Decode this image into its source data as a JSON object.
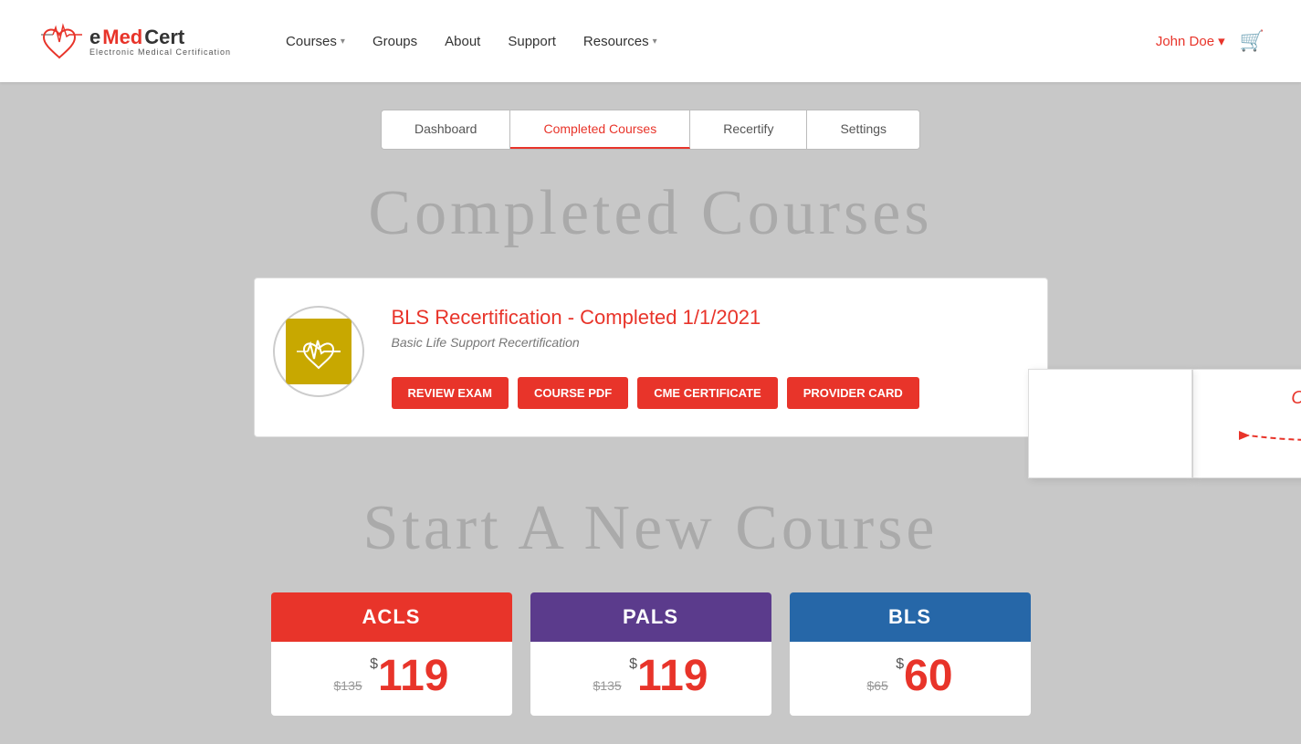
{
  "header": {
    "logo_name": "eMedCert",
    "logo_sub": "Electronic Medical Certification",
    "nav_items": [
      {
        "label": "Courses",
        "has_arrow": true
      },
      {
        "label": "Groups",
        "has_arrow": false
      },
      {
        "label": "About",
        "has_arrow": false
      },
      {
        "label": "Support",
        "has_arrow": false
      },
      {
        "label": "Resources",
        "has_arrow": true
      }
    ],
    "user_name": "John Doe",
    "cart_label": "🛒"
  },
  "tabs": [
    {
      "label": "Dashboard",
      "active": false
    },
    {
      "label": "Completed Courses",
      "active": true
    },
    {
      "label": "Recertify",
      "active": false
    },
    {
      "label": "Settings",
      "active": false
    }
  ],
  "page_title": "Completed Courses",
  "course_card": {
    "title": "BLS Recertification - ",
    "status": "Completed 1/1/2021",
    "subtitle": "Basic Life Support Recertification",
    "buttons": [
      {
        "label": "REVIEW EXAM"
      },
      {
        "label": "COURSE PDF"
      },
      {
        "label": "CME CERTIFICATE"
      },
      {
        "label": "PROVIDER CARD"
      }
    ]
  },
  "callout": {
    "click_here": "Click Here"
  },
  "new_course_section": {
    "title": "Start A New Course",
    "tiles": [
      {
        "name": "ACLS",
        "color_class": "acls-header",
        "old_price": "$135",
        "currency": "$",
        "price": "119"
      },
      {
        "name": "PALS",
        "color_class": "pals-header",
        "old_price": "$135",
        "currency": "$",
        "price": "119"
      },
      {
        "name": "BLS",
        "color_class": "bls-header",
        "old_price": "$65",
        "currency": "$",
        "price": "60"
      }
    ]
  }
}
